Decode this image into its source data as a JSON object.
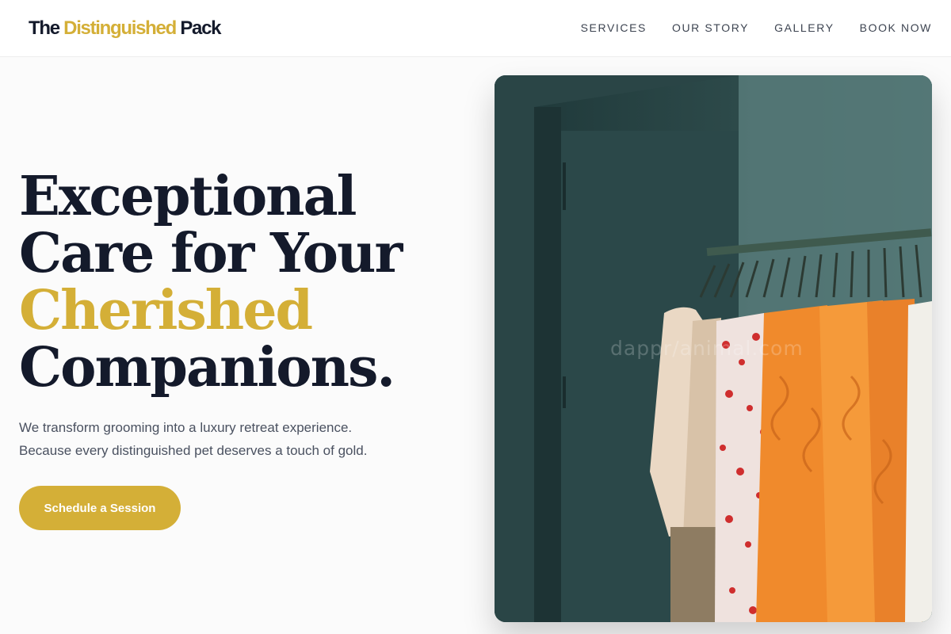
{
  "brand": {
    "part1": "The",
    "part2": "Distinguished",
    "part3": "Pack",
    "gold_color": "#d4af37",
    "dark_color": "#141a2b"
  },
  "nav": {
    "items": [
      {
        "label": "SERVICES"
      },
      {
        "label": "OUR STORY"
      },
      {
        "label": "GALLERY"
      },
      {
        "label": "BOOK NOW"
      }
    ]
  },
  "hero": {
    "title_line1": "Exceptional",
    "title_line2": "Care for Your",
    "title_accent": "Cherished",
    "title_line4": "Companions.",
    "subtitle_line1": "We transform grooming into a luxury retreat experience.",
    "subtitle_line2": "Because every distinguished pet deserves a touch of gold.",
    "cta_label": "Schedule a Session",
    "image_watermark": "dappr/animal.com"
  }
}
